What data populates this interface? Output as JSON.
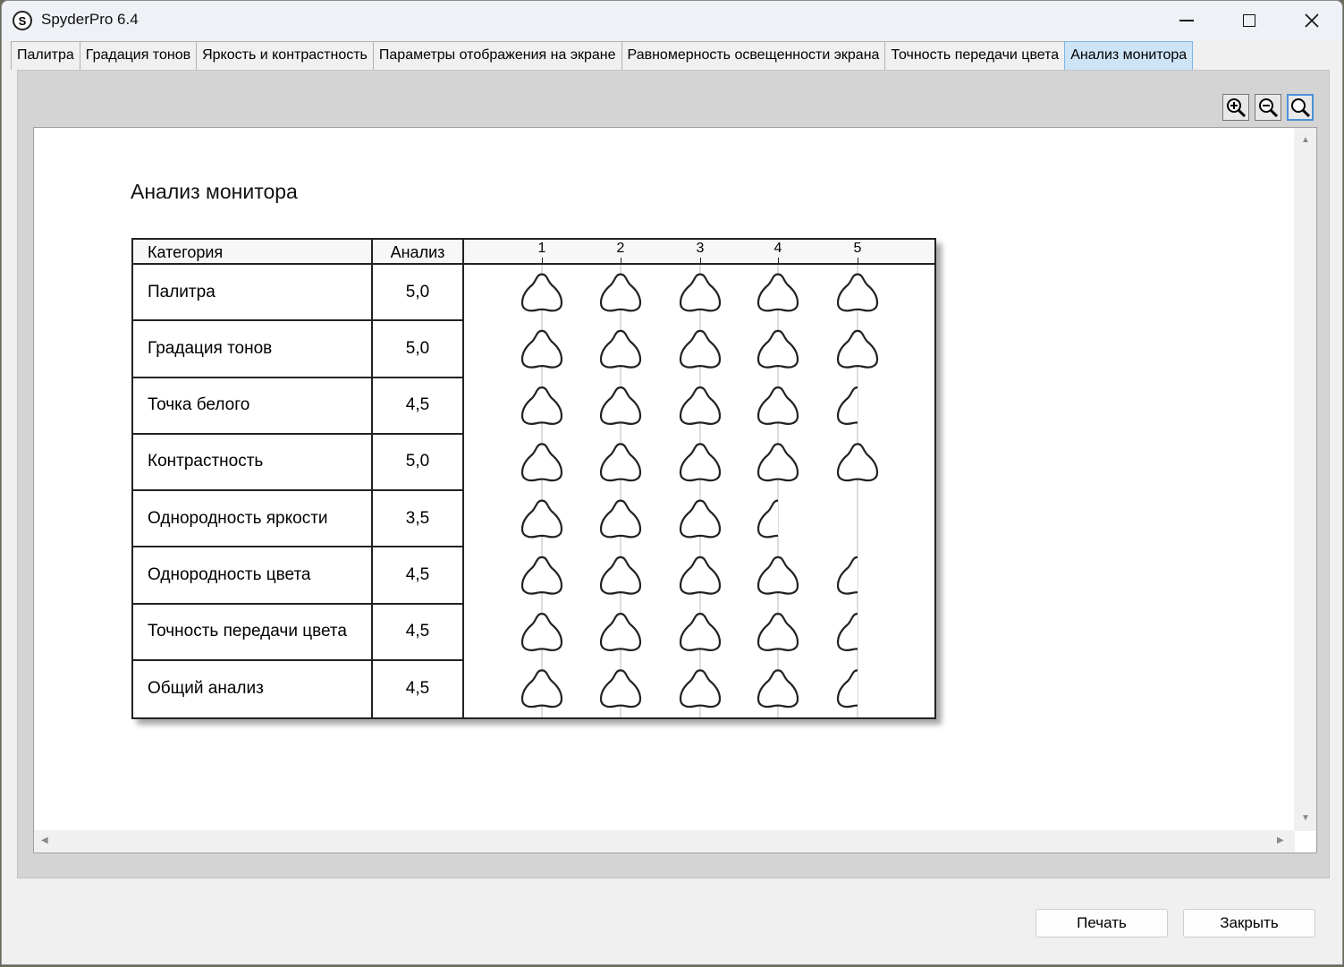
{
  "window": {
    "title": "SpyderPro 6.4",
    "app_icon_letter": "S"
  },
  "tabs": [
    {
      "label": "Палитра",
      "active": false
    },
    {
      "label": "Градация тонов",
      "active": false
    },
    {
      "label": "Яркость и контрастность",
      "active": false
    },
    {
      "label": "Параметры отображения на экране",
      "active": false
    },
    {
      "label": "Равномерность освещенности экрана",
      "active": false
    },
    {
      "label": "Точность передачи цвета",
      "active": false
    },
    {
      "label": "Анализ монитора",
      "active": true
    }
  ],
  "zoom": {
    "zoom_in_icon": "zoom-in-icon",
    "zoom_out_icon": "zoom-out-icon",
    "fit_icon": "zoom-fit-icon"
  },
  "report": {
    "title": "Анализ монитора",
    "headers": {
      "category": "Категория",
      "score": "Анализ"
    },
    "scale": [
      "1",
      "2",
      "3",
      "4",
      "5"
    ],
    "rows": [
      {
        "category": "Палитра",
        "score": "5,0",
        "rating": 5.0
      },
      {
        "category": "Градация тонов",
        "score": "5,0",
        "rating": 5.0
      },
      {
        "category": "Точка белого",
        "score": "4,5",
        "rating": 4.5
      },
      {
        "category": "Контрастность",
        "score": "5,0",
        "rating": 5.0
      },
      {
        "category": "Однородность яркости",
        "score": "3,5",
        "rating": 3.5
      },
      {
        "category": "Однородность цвета",
        "score": "4,5",
        "rating": 4.5
      },
      {
        "category": "Точность передачи цвета",
        "score": "4,5",
        "rating": 4.5
      },
      {
        "category": "Общий анализ",
        "score": "4,5",
        "rating": 4.5
      }
    ]
  },
  "buttons": {
    "print": "Печать",
    "close": "Закрыть"
  },
  "colors": {
    "active_tab": "#cde4f7",
    "active_tab_border": "#7eb4ea",
    "panel": "#d4d4d4"
  }
}
